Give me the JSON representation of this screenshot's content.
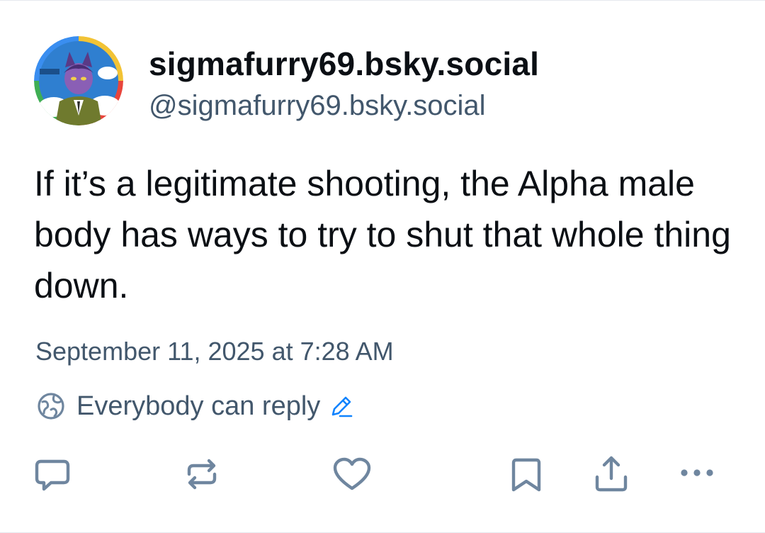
{
  "post": {
    "display_name": "sigmafurry69.bsky.social",
    "handle": "@sigmafurry69.bsky.social",
    "text": "If it’s a legitimate shooting, the Alpha male body has ways to try to shut that whole thing down.",
    "timestamp": "September 11, 2025 at 7:28 AM",
    "reply_setting": "Everybody can reply"
  },
  "icons": {
    "avatar": "cartoon-profile-avatar",
    "reply_setting": "globe-icon",
    "edit": "pencil-icon",
    "actions": [
      "reply-icon",
      "repost-icon",
      "like-icon",
      "bookmark-icon",
      "share-icon",
      "more-icon"
    ]
  },
  "colors": {
    "text": "#0b0f14",
    "secondary_text": "#42576c",
    "accent_blue": "#1083fe",
    "icon_gray": "#6f869f"
  }
}
